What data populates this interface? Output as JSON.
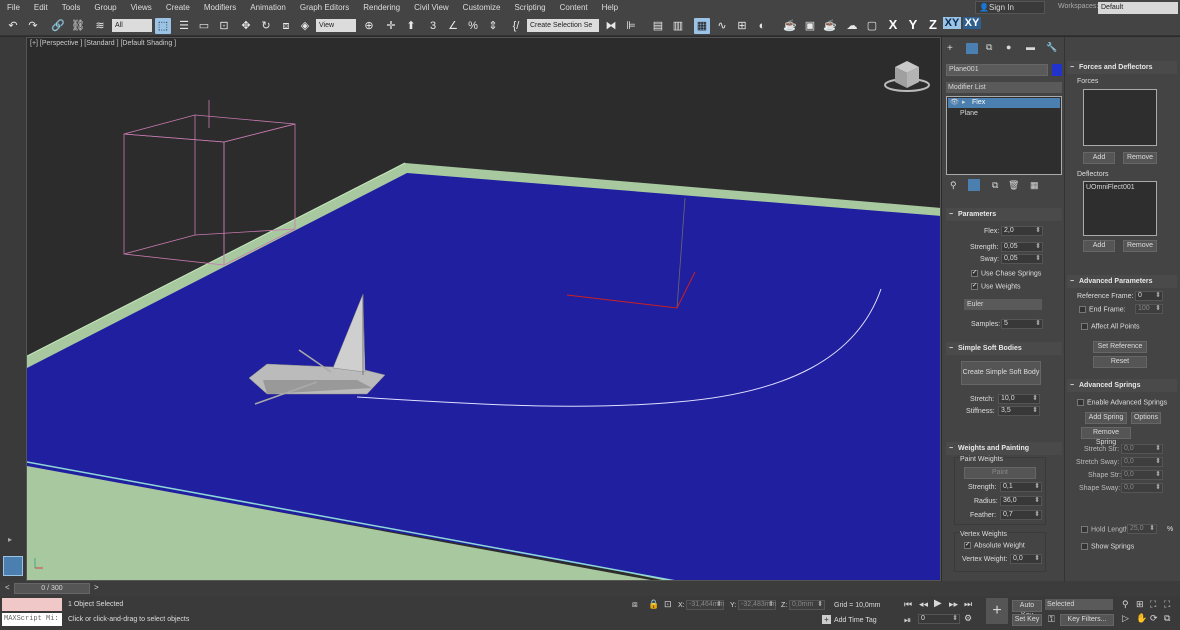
{
  "menu": [
    "File",
    "Edit",
    "Tools",
    "Group",
    "Views",
    "Create",
    "Modifiers",
    "Animation",
    "Graph Editors",
    "Rendering",
    "Civil View",
    "Customize",
    "Scripting",
    "Content",
    "Help"
  ],
  "account": {
    "sign_in": "Sign In",
    "workspaces_label": "Workspaces:",
    "workspace": "Default"
  },
  "toolbar": {
    "filter": "All",
    "ref_coord": "View",
    "selection_set": "Create Selection Se",
    "axis_x": "X",
    "axis_y": "Y",
    "axis_z": "Z",
    "axis_xy": "XY",
    "axis_xy2": "XY"
  },
  "viewport": {
    "label": "[+] [Perspective ] [Standard ] [Default Shading ]"
  },
  "command_panel": {
    "object_name": "Plane001",
    "modifier_list": "Modifier List",
    "stack": [
      "Flex",
      "Plane"
    ],
    "parameters": {
      "title": "Parameters",
      "flex_label": "Flex:",
      "flex": "2,0",
      "strength_label": "Strength:",
      "strength": "0,05",
      "sway_label": "Sway:",
      "sway": "0,05",
      "chase_springs": "Use Chase Springs",
      "use_weights": "Use Weights",
      "solver": "Euler",
      "samples_label": "Samples:",
      "samples": "5"
    },
    "simple_soft": {
      "title": "Simple Soft Bodies",
      "create_button": "Create Simple Soft Body",
      "stretch_label": "Stretch:",
      "stretch": "10,0",
      "stiffness_label": "Stiffness:",
      "stiffness": "3,5"
    },
    "weights_painting": {
      "title": "Weights and Painting",
      "paint_group": "Paint Weights",
      "paint_button": "Paint",
      "strength_label": "Strength:",
      "strength": "0,1",
      "radius_label": "Radius:",
      "radius": "36,0",
      "feather_label": "Feather:",
      "feather": "0,7",
      "vertex_group": "Vertex Weights",
      "absolute": "Absolute Weight",
      "vertex_weight_label": "Vertex Weight:",
      "vertex_weight": "0,0"
    }
  },
  "right_panel": {
    "forces_deflectors": {
      "title": "Forces and Deflectors",
      "forces_label": "Forces",
      "add": "Add",
      "remove": "Remove",
      "deflectors_label": "Deflectors",
      "deflector_item": "UOmniFlect001",
      "add2": "Add",
      "remove2": "Remove"
    },
    "advanced_params": {
      "title": "Advanced Parameters",
      "ref_frame_label": "Reference Frame:",
      "ref_frame": "0",
      "end_frame_label": "End Frame:",
      "end_frame": "100",
      "affect_all": "Affect All Points",
      "set_reference": "Set Reference",
      "reset": "Reset"
    },
    "advanced_springs": {
      "title": "Advanced Springs",
      "enable": "Enable Advanced Springs",
      "add_spring": "Add Spring",
      "options": "Options",
      "remove_spring": "Remove Spring",
      "stretch_str_label": "Stretch Str:",
      "stretch_str": "0,0",
      "stretch_sway_label": "Stretch Sway:",
      "stretch_sway": "0,0",
      "shape_str_label": "Shape Str:",
      "shape_str": "0,0",
      "shape_sway_label": "Shape Sway:",
      "shape_sway": "0,0",
      "hold_length_label": "Hold Length",
      "hold_length": "25,0",
      "percent": "%",
      "show_springs": "Show Springs"
    }
  },
  "timeline": {
    "frame": "0 / 300",
    "prev": "<",
    "next": ">"
  },
  "status": {
    "maxscript": "MAXScript Mi:",
    "selected": "1 Object Selected",
    "prompt": "Click or click-and-drag to select objects",
    "x_label": "X:",
    "x": "-31,464mm",
    "y_label": "Y:",
    "y": "-32,483mm",
    "z_label": "Z:",
    "z": "0,0mm",
    "grid": "Grid = 10,0mm",
    "add_time_tag": "Add Time Tag",
    "auto_key": "Auto Key",
    "set_key": "Set Key",
    "key_mode": "Selected",
    "key_filters": "Key Filters...",
    "frame_field": "0"
  }
}
